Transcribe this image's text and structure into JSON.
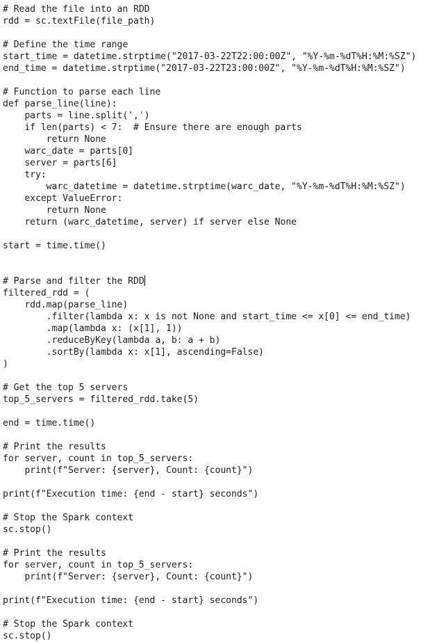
{
  "editor": {
    "cursor_line_index": 23,
    "lines": [
      "# Read the file into an RDD",
      "rdd = sc.textFile(file_path)",
      "",
      "# Define the time range",
      "start_time = datetime.strptime(\"2017-03-22T22:00:00Z\", \"%Y-%m-%dT%H:%M:%SZ\")",
      "end_time = datetime.strptime(\"2017-03-22T23:00:00Z\", \"%Y-%m-%dT%H:%M:%SZ\")",
      "",
      "# Function to parse each line",
      "def parse_line(line):",
      "    parts = line.split(',')",
      "    if len(parts) < 7:  # Ensure there are enough parts",
      "        return None",
      "    warc_date = parts[0]",
      "    server = parts[6]",
      "    try:",
      "        warc_datetime = datetime.strptime(warc_date, \"%Y-%m-%dT%H:%M:%SZ\")",
      "    except ValueError:",
      "        return None",
      "    return (warc_datetime, server) if server else None",
      "",
      "start = time.time()",
      "",
      "",
      "# Parse and filter the RDD",
      "filtered_rdd = (",
      "    rdd.map(parse_line)",
      "        .filter(lambda x: x is not None and start_time <= x[0] <= end_time)",
      "        .map(lambda x: (x[1], 1))",
      "        .reduceByKey(lambda a, b: a + b)",
      "        .sortBy(lambda x: x[1], ascending=False)",
      ")",
      "",
      "# Get the top 5 servers",
      "top_5_servers = filtered_rdd.take(5)",
      "",
      "end = time.time()",
      "",
      "# Print the results",
      "for server, count in top_5_servers:",
      "    print(f\"Server: {server}, Count: {count}\")",
      "",
      "print(f\"Execution time: {end - start} seconds\")",
      "",
      "# Stop the Spark context",
      "sc.stop()",
      "",
      "# Print the results",
      "for server, count in top_5_servers:",
      "    print(f\"Server: {server}, Count: {count}\")",
      "",
      "print(f\"Execution time: {end - start} seconds\")",
      "",
      "# Stop the Spark context",
      "sc.stop()"
    ]
  }
}
